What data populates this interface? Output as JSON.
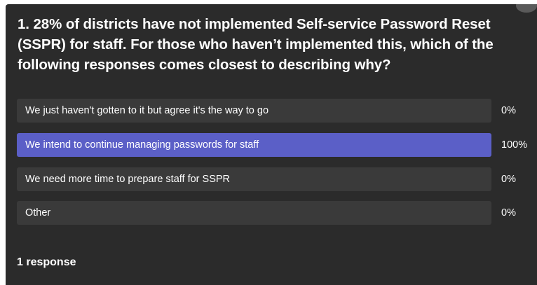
{
  "poll": {
    "question": "1. 28% of districts have not implemented Self-service Password Reset (SSPR) for staff. For those who haven’t implemented this, which of the following responses comes closest to describing why?",
    "options": [
      {
        "label": "We just haven't gotten to it but agree it's the way to go",
        "percent_text": "0%",
        "percent": 0,
        "selected": false
      },
      {
        "label": "We intend to continue managing passwords for staff",
        "percent_text": "100%",
        "percent": 100,
        "selected": true
      },
      {
        "label": "We need more time to prepare staff for SSPR",
        "percent_text": "0%",
        "percent": 0,
        "selected": false
      },
      {
        "label": "Other",
        "percent_text": "0%",
        "percent": 0,
        "selected": false
      }
    ],
    "response_count": "1 response"
  },
  "colors": {
    "card_background": "#2b2b2b",
    "bar_background": "#3a3a3a",
    "bar_fill": "#5b5fc7",
    "text": "#ffffff"
  }
}
